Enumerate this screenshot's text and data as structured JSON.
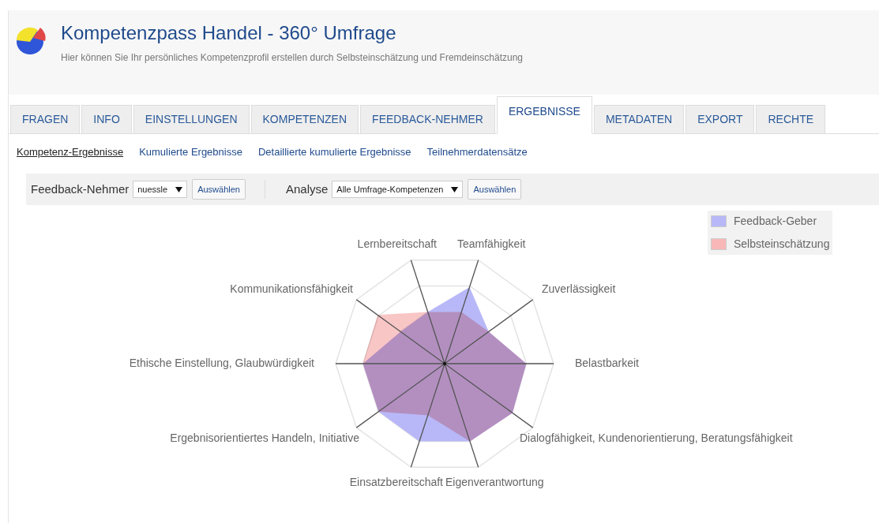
{
  "header": {
    "title": "Kompetenzpass Handel - 360° Umfrage",
    "subtitle": "Hier können Sie Ihr persönliches Kompetenzprofil erstellen durch Selbsteinschätzung und Fremdeinschätzung"
  },
  "tabs": [
    {
      "label": "FRAGEN",
      "selected": false
    },
    {
      "label": "INFO",
      "selected": false
    },
    {
      "label": "EINSTELLUNGEN",
      "selected": false
    },
    {
      "label": "KOMPETENZEN",
      "selected": false
    },
    {
      "label": "FEEDBACK-NEHMER",
      "selected": false
    },
    {
      "label": "ERGEBNISSE",
      "selected": true
    },
    {
      "label": "METADATEN",
      "selected": false
    },
    {
      "label": "EXPORT",
      "selected": false
    },
    {
      "label": "RECHTE",
      "selected": false
    }
  ],
  "subtabs": [
    {
      "label": "Kompetenz-Ergebnisse",
      "selected": true
    },
    {
      "label": "Kumulierte Ergebnisse",
      "selected": false
    },
    {
      "label": "Detaillierte kumulierte Ergebnisse",
      "selected": false
    },
    {
      "label": "Teilnehmerdatensätze",
      "selected": false
    }
  ],
  "filters": [
    {
      "label": "Feedback-Nehmer",
      "value": "nuessle",
      "button": "Auswählen"
    },
    {
      "label": "Analyse",
      "value": "Alle Umfrage-Kompetenzen",
      "button": "Auswählen"
    }
  ],
  "radar": {
    "axes": [
      "Lernbereitschaft",
      "Teamfähigkeit",
      "Kommunikationsfähigkeit",
      "Zuverlässigkeit",
      "Ethische Einstellung, Glaubwürdigkeit",
      "Belastbarkeit",
      "Ergebnisorientiertes Handeln, Initiative",
      "Dialogfähigkeit, Kundenorientierung, Beratungsfähigkeit",
      "Einsatzbereitschaft",
      "Eigenverantwortung"
    ],
    "legend": [
      {
        "name": "Feedback-Geber",
        "color": "#b8b8f8"
      },
      {
        "name": "Selbsteinschätzung",
        "color": "#f8b8b8"
      }
    ]
  }
}
